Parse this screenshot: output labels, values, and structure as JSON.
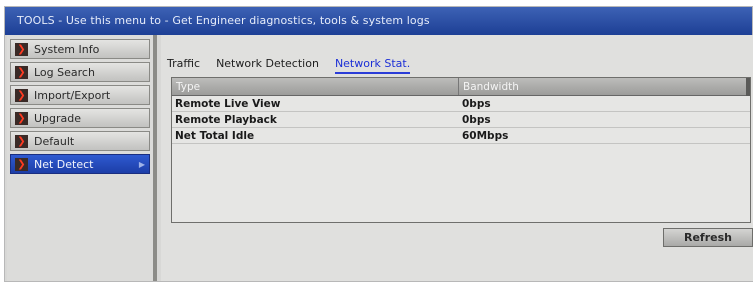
{
  "window": {
    "title": "TOOLS - Use this menu to - Get Engineer diagnostics, tools & system logs"
  },
  "sidebar": {
    "items": [
      {
        "label": "System Info"
      },
      {
        "label": "Log Search"
      },
      {
        "label": "Import/Export"
      },
      {
        "label": "Upgrade"
      },
      {
        "label": "Default"
      },
      {
        "label": "Net Detect",
        "active": true
      }
    ]
  },
  "tabs": [
    {
      "label": "Traffic"
    },
    {
      "label": "Network Detection"
    },
    {
      "label": "Network Stat.",
      "active": true
    }
  ],
  "table": {
    "columns": [
      "Type",
      "Bandwidth"
    ],
    "rows": [
      {
        "type": "Remote Live View",
        "bandwidth": "0bps"
      },
      {
        "type": "Remote Playback",
        "bandwidth": "0bps"
      },
      {
        "type": "Net Total Idle",
        "bandwidth": "60Mbps"
      }
    ]
  },
  "buttons": {
    "refresh": "Refresh"
  },
  "colors": {
    "title_bar": "#2a4ea8",
    "active_item": "#2a50c4",
    "active_tab": "#1c2fd6",
    "chevron": "#ff3b22"
  },
  "icons": {
    "sidebar_chevron": "chevron-right-icon"
  }
}
